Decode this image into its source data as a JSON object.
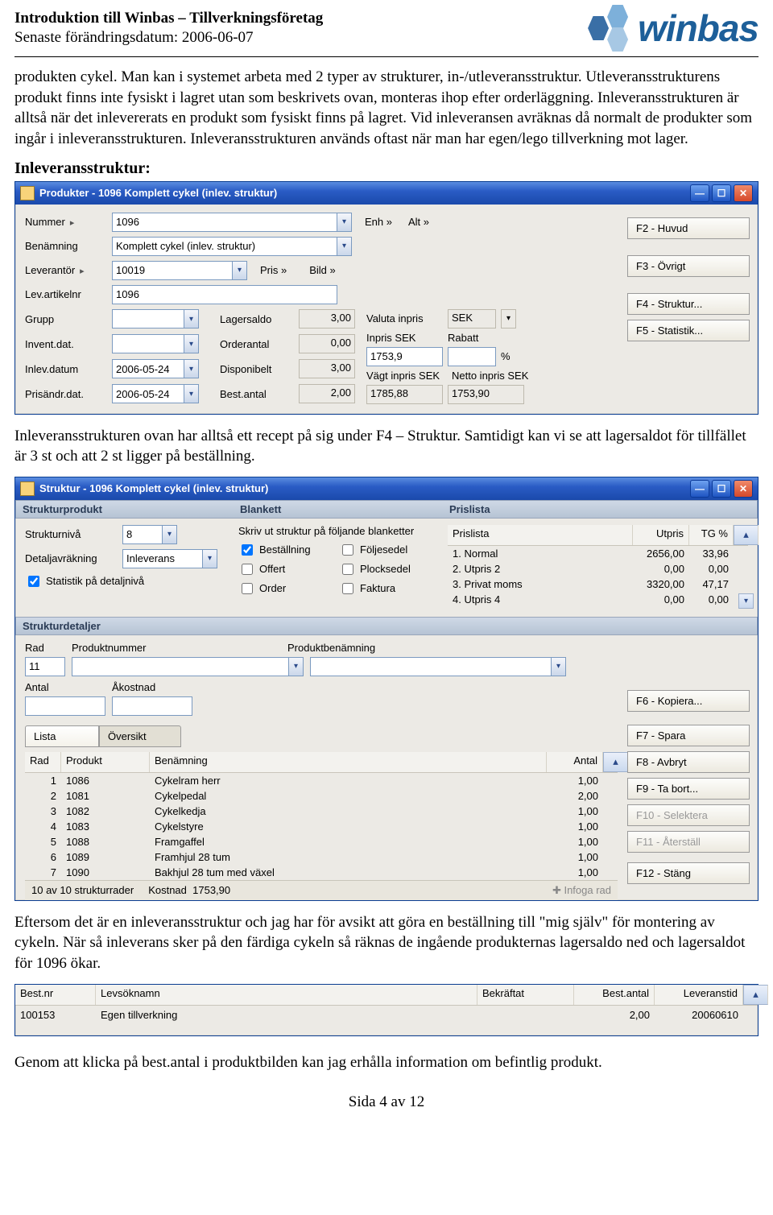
{
  "header": {
    "title": "Introduktion till Winbas – Tillverkningsföretag",
    "date": "Senaste förändringsdatum: 2006-06-07",
    "logo_text": "winbas"
  },
  "para1": "produkten cykel. Man kan i systemet arbeta med 2 typer av strukturer, in-/utleveransstruktur. Utleveransstrukturens produkt finns inte fysiskt i lagret utan som beskrivets ovan, monteras ihop efter orderläggning. Inleveransstrukturen är alltså när det inlevererats en produkt som fysiskt finns på lagret. Vid inleveransen avräknas då normalt de produkter som ingår i inleveransstrukturen. Inleveransstrukturen används oftast när man har egen/lego tillverkning mot lager.",
  "heading_inlev": "Inleveransstruktur:",
  "win1": {
    "title": "Produkter - 1096 Komplett cykel (inlev. struktur)",
    "labels": {
      "nummer": "Nummer",
      "benamning": "Benämning",
      "leverantor": "Leverantör",
      "levartikelnr": "Lev.artikelnr",
      "grupp": "Grupp",
      "inventdat": "Invent.dat.",
      "inlevdat": "Inlev.datum",
      "prisandrdat": "Prisändr.dat.",
      "lagersaldo": "Lagersaldo",
      "orderantal": "Orderantal",
      "disponibelt": "Disponibelt",
      "bestantal": "Best.antal",
      "enh": "Enh »",
      "alt": "Alt »",
      "pris": "Pris »",
      "bild": "Bild »",
      "valuta": "Valuta inpris",
      "inpris": "Inpris SEK",
      "rabatt": "Rabatt",
      "vagt": "Vägt inpris SEK",
      "netto": "Netto inpris SEK"
    },
    "values": {
      "nummer": "1096",
      "benamning": "Komplett cykel (inlev. struktur)",
      "leverantor": "10019",
      "levartikelnr": "1096",
      "grupp": "",
      "inventdat": "",
      "inlevdat": "2006-05-24",
      "prisandrdat": "2006-05-24",
      "lagersaldo": "3,00",
      "orderantal": "0,00",
      "disponibelt": "3,00",
      "bestantal": "2,00",
      "valuta": "SEK",
      "inpris": "1753,9",
      "rabatt_unit": "%",
      "vagt": "1785,88",
      "netto": "1753,90"
    },
    "buttons": {
      "f2": "F2 - Huvud",
      "f3": "F3 - Övrigt",
      "f4": "F4 - Struktur...",
      "f5": "F5 - Statistik..."
    }
  },
  "para2": "Inleveransstrukturen ovan har alltså ett recept på sig under F4 – Struktur. Samtidigt kan vi se att lagersaldot för tillfället är 3 st och att 2 st ligger på beställning.",
  "win2": {
    "title": "Struktur - 1096 Komplett cykel (inlev. struktur)",
    "section_sp": "Strukturprodukt",
    "section_bl": "Blankett",
    "section_pl": "Prislista",
    "section_sd": "Strukturdetaljer",
    "labels": {
      "niva": "Strukturnivå",
      "detalj": "Detaljavräkning",
      "stat": "Statistik på detaljnivå",
      "rad": "Rad",
      "prodnr": "Produktnummer",
      "prodben": "Produktbenämning",
      "antal": "Antal",
      "akostnad": "Åkostnad",
      "lista": "Lista",
      "oversikt": "Översikt",
      "blankett_text": "Skriv ut struktur på följande blanketter",
      "prislista": "Prislista",
      "utpris": "Utpris",
      "tg": "TG %"
    },
    "values": {
      "niva": "8",
      "detalj": "Inleverans",
      "rad": "11",
      "prodnr": "",
      "prodben": "",
      "antal": "",
      "akostnad": ""
    },
    "blanketter": [
      {
        "name": "Beställning",
        "checked": true
      },
      {
        "name": "Följesedel",
        "checked": false
      },
      {
        "name": "Offert",
        "checked": false
      },
      {
        "name": "Plocksedel",
        "checked": false
      },
      {
        "name": "Order",
        "checked": false
      },
      {
        "name": "Faktura",
        "checked": false
      }
    ],
    "prislista": [
      {
        "name": "1. Normal",
        "utpris": "2656,00",
        "tg": "33,96"
      },
      {
        "name": "2. Utpris 2",
        "utpris": "0,00",
        "tg": "0,00"
      },
      {
        "name": "3. Privat moms",
        "utpris": "3320,00",
        "tg": "47,17"
      },
      {
        "name": "4. Utpris 4",
        "utpris": "0,00",
        "tg": "0,00"
      }
    ],
    "listcols": {
      "rad": "Rad",
      "produkt": "Produkt",
      "benamning": "Benämning",
      "antal": "Antal"
    },
    "rows": [
      {
        "rad": "1",
        "produkt": "1086",
        "ben": "Cykelram herr",
        "antal": "1,00"
      },
      {
        "rad": "2",
        "produkt": "1081",
        "ben": "Cykelpedal",
        "antal": "2,00"
      },
      {
        "rad": "3",
        "produkt": "1082",
        "ben": "Cykelkedja",
        "antal": "1,00"
      },
      {
        "rad": "4",
        "produkt": "1083",
        "ben": "Cykelstyre",
        "antal": "1,00"
      },
      {
        "rad": "5",
        "produkt": "1088",
        "ben": "Framgaffel",
        "antal": "1,00"
      },
      {
        "rad": "6",
        "produkt": "1089",
        "ben": "Framhjul 28 tum",
        "antal": "1,00"
      },
      {
        "rad": "7",
        "produkt": "1090",
        "ben": "Bakhjul 28 tum med växel",
        "antal": "1,00"
      }
    ],
    "status": {
      "count": "10 av 10 strukturrader",
      "kostnad_lbl": "Kostnad",
      "kostnad_val": "1753,90",
      "infoga": "Infoga rad"
    },
    "buttons": {
      "f6": "F6 - Kopiera...",
      "f7": "F7 - Spara",
      "f8": "F8 - Avbryt",
      "f9": "F9 - Ta bort...",
      "f10": "F10 - Selektera",
      "f11": "F11 - Återställ",
      "f12": "F12 - Stäng"
    }
  },
  "para3": "Eftersom det är en inleveransstruktur och jag har för avsikt att göra en beställning till \"mig själv\" för montering av cykeln. När så inleverans sker på den färdiga cykeln så räknas de ingående produkternas lagersaldo ned och lagersaldot för 1096 ökar.",
  "win3": {
    "cols": {
      "bestnr": "Best.nr",
      "lev": "Levsöknamn",
      "bekr": "Bekräftat",
      "antal": "Best.antal",
      "tid": "Leveranstid"
    },
    "row": {
      "bestnr": "100153",
      "lev": "Egen tillverkning",
      "bekr": "",
      "antal": "2,00",
      "tid": "20060610"
    }
  },
  "para4": "Genom att klicka på best.antal i produktbilden kan jag erhålla information om befintlig produkt.",
  "footer": "Sida 4 av 12"
}
